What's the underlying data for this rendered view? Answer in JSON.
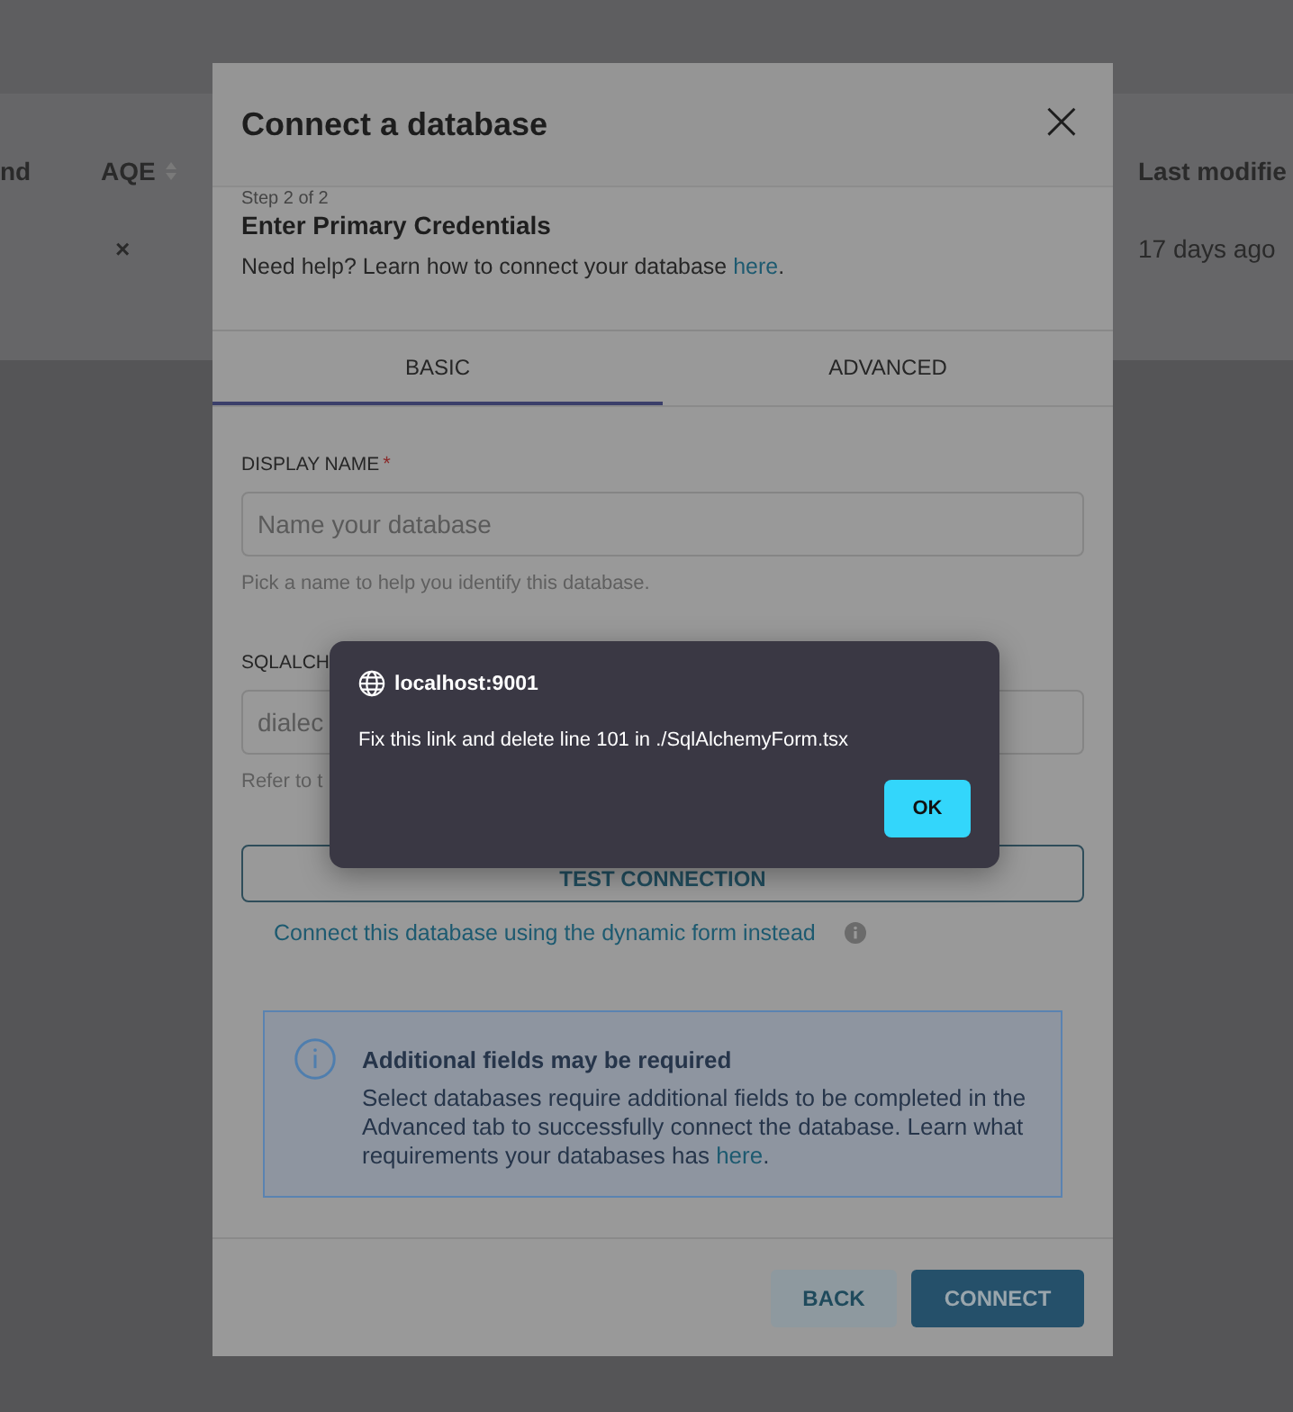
{
  "background_table": {
    "columns": [
      {
        "label": "nd"
      },
      {
        "label": "AQE",
        "sortable": true
      },
      {
        "label": "Last modifie"
      }
    ],
    "row": {
      "aqe": "×",
      "last_modified": "17 days ago"
    }
  },
  "modal": {
    "title": "Connect a database",
    "close": "×",
    "step": "Step 2 of 2",
    "heading": "Enter Primary Credentials",
    "help": {
      "text": "Need help? Learn how to connect your database ",
      "link": "here",
      "after": "."
    },
    "tabs": [
      {
        "label": "BASIC",
        "selected": true
      },
      {
        "label": "ADVANCED",
        "selected": false
      }
    ],
    "fields": [
      {
        "label": "DISPLAY NAME",
        "required_mark": "*",
        "placeholder": "Name your database",
        "hint": "Pick a name to help you identify this database."
      },
      {
        "label": "SQLALCH",
        "placeholder": "dialec",
        "hint": "Refer to t"
      }
    ],
    "test_button": "TEST CONNECTION",
    "dynamic_link": "Connect this database using the dynamic form instead",
    "notice": {
      "title": "Additional fields may be required",
      "text": "Select databases require additional fields to be completed in the Advanced tab to successfully connect the database. Learn what requirements your databases has ",
      "link": "here",
      "after": "."
    },
    "buttons": [
      {
        "label": "BACK",
        "kind": "secondary"
      },
      {
        "label": "CONNECT",
        "kind": "primary"
      }
    ]
  },
  "alert": {
    "origin": "localhost:9001",
    "message": "Fix this link and delete line 101 in ./SqlAlchemyForm.tsx",
    "button": "OK"
  }
}
